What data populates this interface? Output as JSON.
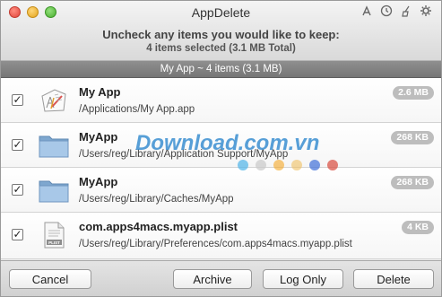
{
  "window": {
    "title": "AppDelete"
  },
  "toolbar_icons": [
    "app-store-icon",
    "clock-icon",
    "broom-icon",
    "gear-icon"
  ],
  "header": {
    "prompt": "Uncheck any items you would like to keep:",
    "summary": "4 items selected (3.1 MB Total)"
  },
  "group": {
    "title": "My App ~ 4 items (3.1 MB)"
  },
  "items": [
    {
      "checked": true,
      "icon": "app-icon",
      "name": "My App",
      "path": "/Applications/My App.app",
      "size": "2.6 MB"
    },
    {
      "checked": true,
      "icon": "folder-icon",
      "name": "MyApp",
      "path": "/Users/reg/Library/Application Support/MyApp",
      "size": "268 KB"
    },
    {
      "checked": true,
      "icon": "folder-icon",
      "name": "MyApp",
      "path": "/Users/reg/Library/Caches/MyApp",
      "size": "268 KB"
    },
    {
      "checked": true,
      "icon": "plist-icon",
      "icon_label": "PLIST",
      "name": "com.apps4macs.myapp.plist",
      "path": "/Users/reg/Library/Preferences/com.apps4macs.myapp.plist",
      "size": "4 KB"
    }
  ],
  "watermark": {
    "text": "Download.com.vn",
    "dot_colors": [
      "#4fb3e8",
      "#e7453b",
      "#f5a623",
      "#8bc34a",
      "#3e6fd8",
      "#d94a3d"
    ]
  },
  "buttons": {
    "cancel": "Cancel",
    "archive": "Archive",
    "log_only": "Log Only",
    "delete": "Delete"
  }
}
